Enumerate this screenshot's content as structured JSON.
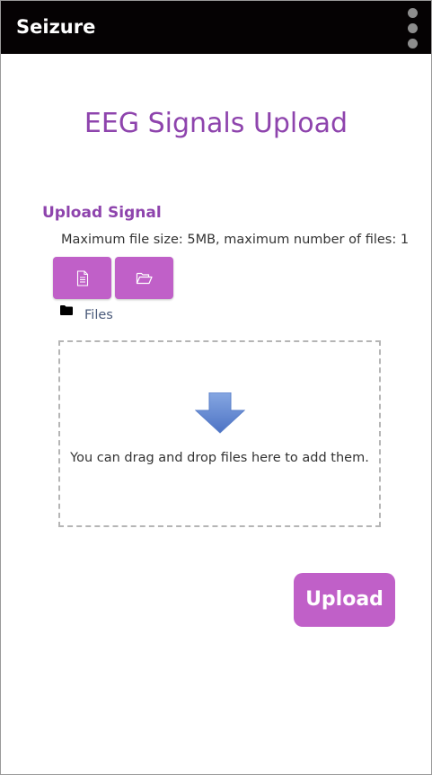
{
  "app": {
    "title": "Seizure"
  },
  "header": {
    "menu_icon": "more-vertical-icon"
  },
  "page": {
    "title": "EEG Signals Upload"
  },
  "upload_form": {
    "section_label": "Upload Signal",
    "limits_text": "Maximum file size: 5MB, maximum number of files: 1",
    "add_file_icon": "file-icon",
    "create_folder_icon": "folder-open-icon",
    "folder_label": "Files",
    "folder_icon": "folder-icon",
    "dropzone_text": "You can drag and drop files here to add them.",
    "dropzone_icon": "down-arrow-icon",
    "submit_label": "Upload"
  },
  "colors": {
    "accent": "#8e44ad",
    "button": "#c060c8",
    "topbar": "#050203"
  }
}
